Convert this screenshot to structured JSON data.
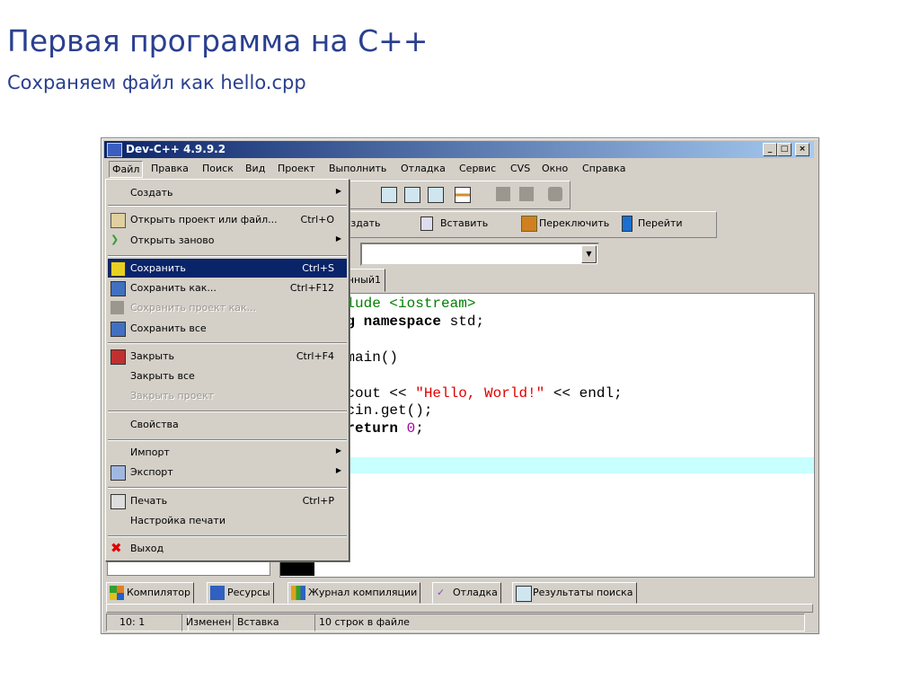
{
  "slide": {
    "title": "Первая программа на C++",
    "subtitle": "Сохраняем файл как hello.cpp"
  },
  "window": {
    "title": "Dev-C++ 4.9.9.2",
    "minimize": "_",
    "maximize": "□",
    "close": "×"
  },
  "menubar": [
    "Файл",
    "Правка",
    "Поиск",
    "Вид",
    "Проект",
    "Выполнить",
    "Отладка",
    "Сервис",
    "CVS",
    "Окно",
    "Справка"
  ],
  "toolbar2": {
    "create": "Создать",
    "insert": "Вставить",
    "switch": "Переключить",
    "goto": "Перейти"
  },
  "editor_tab": "Безымянный1",
  "code": [
    "#include <iostream>",
    "using namespace std;",
    "",
    "int main()",
    "{",
    "    cout << ",
    "\"Hello, World!\"",
    " << endl;",
    "    cin.get();",
    "    return ",
    "0",
    ";",
    "}"
  ],
  "file_menu": [
    {
      "label": "Создать",
      "submenu": true
    },
    {
      "label": "Открыть проект или файл...",
      "shortcut": "Ctrl+O"
    },
    {
      "label": "Открыть заново",
      "submenu": true
    },
    {
      "label": "Сохранить",
      "shortcut": "Ctrl+S",
      "highlighted": true
    },
    {
      "label": "Сохранить как...",
      "shortcut": "Ctrl+F12"
    },
    {
      "label": "Сохранить проект как...",
      "disabled": true
    },
    {
      "label": "Сохранить все"
    },
    {
      "label": "Закрыть",
      "shortcut": "Ctrl+F4"
    },
    {
      "label": "Закрыть все"
    },
    {
      "label": "Закрыть проект",
      "disabled": true
    },
    {
      "label": "Свойства"
    },
    {
      "label": "Импорт",
      "submenu": true
    },
    {
      "label": "Экспорт",
      "submenu": true
    },
    {
      "label": "Печать",
      "shortcut": "Ctrl+P"
    },
    {
      "label": "Настройка печати"
    },
    {
      "label": "Выход"
    }
  ],
  "bottom_tabs": [
    "Компилятор",
    "Ресурсы",
    "Журнал компиляции",
    "Отладка",
    "Результаты поиска"
  ],
  "status": {
    "pos": "10: 1",
    "modified": "Изменен",
    "mode": "Вставка",
    "info": "10 строк в файле"
  },
  "colors": {
    "accent": "#0a246a",
    "string": "#e00000",
    "preproc": "#008000",
    "number": "#a000a0"
  }
}
